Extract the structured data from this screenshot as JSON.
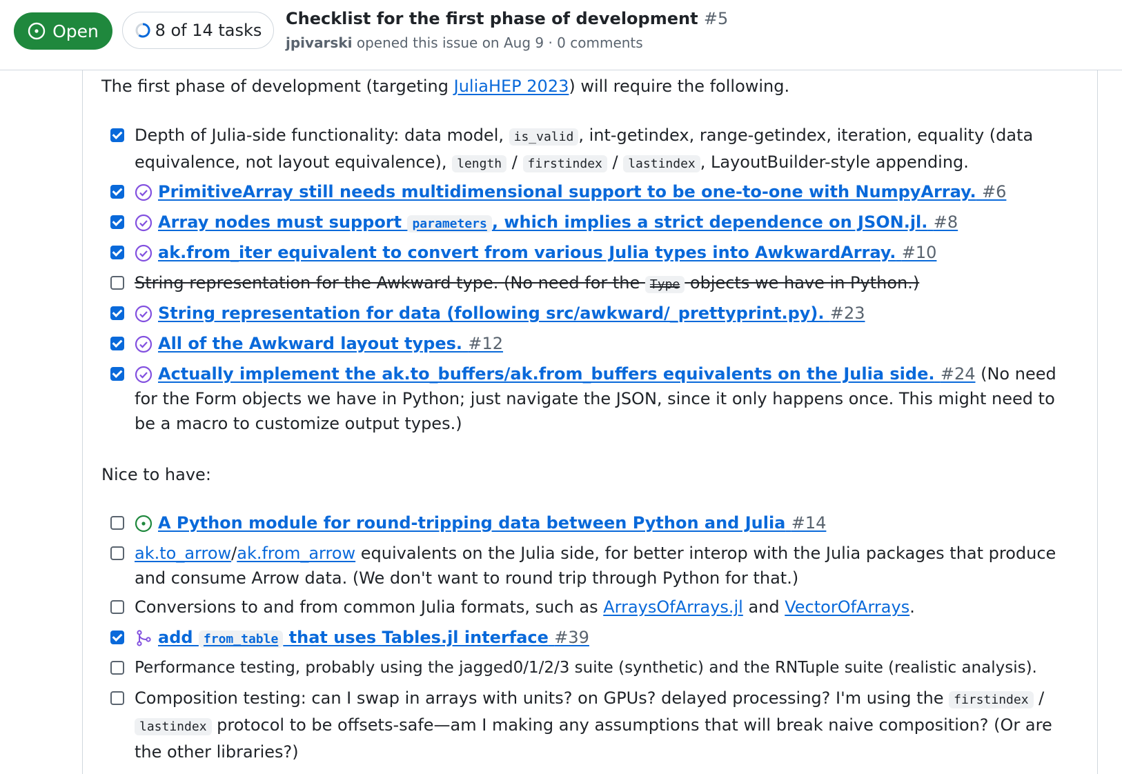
{
  "header": {
    "state": "Open",
    "tasks": "8 of 14 tasks",
    "title": "Checklist for the first phase of development",
    "number": "#5",
    "author": "jpivarski",
    "meta": "opened this issue on Aug 9 · 0 comments"
  },
  "intro": {
    "before": "The first phase of development (targeting ",
    "link": "JuliaHEP 2023",
    "after": ") will require the following."
  },
  "items1": {
    "i1": {
      "a": "Depth of Julia-side functionality: data model, ",
      "code1": "is_valid",
      "b": ", int-getindex, range-getindex, iteration, equality (data equivalence, not layout equivalence), ",
      "code2": "length",
      "sep1": " / ",
      "code3": "firstindex",
      "sep2": " / ",
      "code4": "lastindex",
      "c": ", LayoutBuilder-style appending."
    },
    "i2": {
      "title": "PrimitiveArray still needs multidimensional support to be one-to-one with NumpyArray.",
      "ref": "#6"
    },
    "i3": {
      "a": "Array nodes must support ",
      "code": "parameters",
      "b": ", which implies a strict dependence on JSON.jl.",
      "ref": "#8"
    },
    "i4": {
      "title": "ak.from_iter equivalent to convert from various Julia types into AwkwardArray.",
      "ref": "#10"
    },
    "i5": {
      "a": "String representation for the Awkward type. (No need for the ",
      "code": "Type",
      "b": " objects we have in Python.)"
    },
    "i6": {
      "title": "String representation for data (following src/awkward/_prettyprint.py).",
      "ref": "#23"
    },
    "i7": {
      "title": "All of the Awkward layout types.",
      "ref": "#12"
    },
    "i8": {
      "title": "Actually implement the ak.to_buffers/ak.from_buffers equivalents on the Julia side.",
      "ref": "#24",
      "rest": " (No need for the Form objects we have in Python; just navigate the JSON, since it only happens once. This might need to be a macro to customize output types.)"
    }
  },
  "nice": "Nice to have:",
  "items2": {
    "j1": {
      "title": "A Python module for round-tripping data between Python and Julia",
      "ref": "#14"
    },
    "j2": {
      "link1": "ak.to_arrow",
      "sep": "/",
      "link2": "ak.from_arrow",
      "rest": " equivalents on the Julia side, for better interop with the Julia packages that produce and consume Arrow data. (We don't want to round trip through Python for that.)"
    },
    "j3": {
      "a": "Conversions to and from common Julia formats, such as ",
      "link1": "ArraysOfArrays.jl",
      "mid": " and ",
      "link2": "VectorOfArrays",
      "end": "."
    },
    "j4": {
      "a": "add ",
      "code": "from_table",
      "b": " that uses Tables.jl interface",
      "ref": "#39"
    },
    "j5": {
      "text": "Performance testing, probably using the jagged0/1/2/3 suite (synthetic) and the RNTuple suite (realistic analysis)."
    },
    "j6": {
      "a": "Composition testing: can I swap in arrays with units? on GPUs? delayed processing? I'm using the ",
      "code1": "firstindex",
      "sep": " / ",
      "code2": "lastindex",
      "b": " protocol to be offsets-safe—am I making any assumptions that will break naive composition? (Or are the other libraries?)"
    }
  },
  "colors": {
    "open": "#1f883d",
    "link": "#0969da",
    "closed": "#8250df",
    "muted": "#59636e"
  }
}
